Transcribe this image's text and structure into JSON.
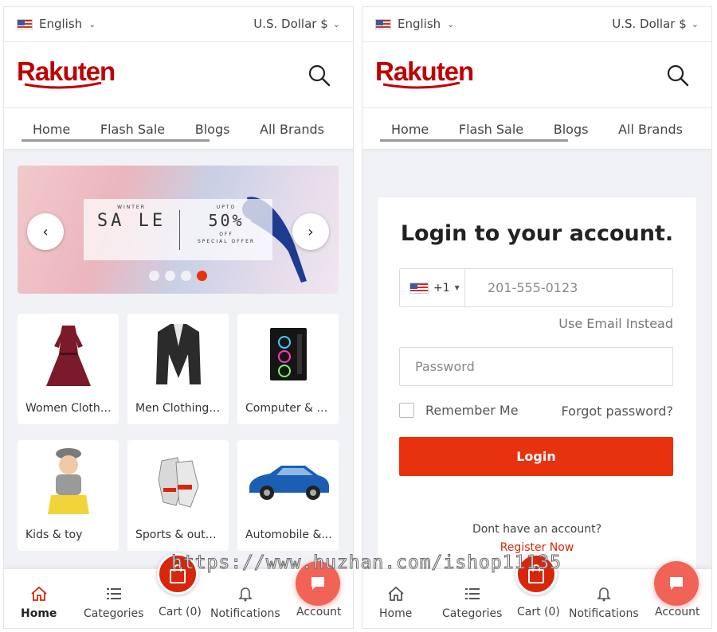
{
  "panels": {
    "left": {
      "topbar": {
        "language": "English",
        "currency": "U.S. Dollar $"
      },
      "nav": [
        "Home",
        "Flash Sale",
        "Blogs",
        "All Brands"
      ],
      "banner": {
        "winter": "WINTER",
        "sale": "SA LE",
        "upto": "UPTO",
        "percent": "50%",
        "off": "OFF",
        "special": "SPECIAL OFFER",
        "active_slide": 4,
        "slides": 4
      },
      "categories": [
        {
          "label": "Women Clothi...",
          "icon": "dress-icon"
        },
        {
          "label": "Men Clothing ...",
          "icon": "blazer-icon"
        },
        {
          "label": "Computer & A...",
          "icon": "pc-case-icon"
        },
        {
          "label": "Kids & toy",
          "icon": "child-icon"
        },
        {
          "label": "Sports & outd...",
          "icon": "gloves-icon"
        },
        {
          "label": "Automobile &...",
          "icon": "car-icon"
        }
      ],
      "bottom_nav": {
        "home": "Home",
        "categories": "Categories",
        "cart": "Cart (0)",
        "notifications": "Notifications",
        "account": "Account",
        "active": "home"
      }
    },
    "right": {
      "topbar": {
        "language": "English",
        "currency": "U.S. Dollar $"
      },
      "nav": [
        "Home",
        "Flash Sale",
        "Blogs",
        "All Brands"
      ],
      "login": {
        "title": "Login to your account.",
        "country_code": "+1",
        "phone_placeholder": "201-555-0123",
        "use_email": "Use Email Instead",
        "password_placeholder": "Password",
        "remember": "Remember Me",
        "forgot": "Forgot password?",
        "button": "Login",
        "no_account": "Dont have an account?",
        "register": "Register Now"
      },
      "bottom_nav": {
        "home": "Home",
        "categories": "Categories",
        "cart": "Cart (0)",
        "notifications": "Notifications",
        "account": "Account"
      }
    }
  },
  "brand": {
    "name": "Rakuten",
    "color": "#bf0000",
    "accent": "#e8320e"
  },
  "watermark": "https://www.huzhan.com/ishop11135"
}
